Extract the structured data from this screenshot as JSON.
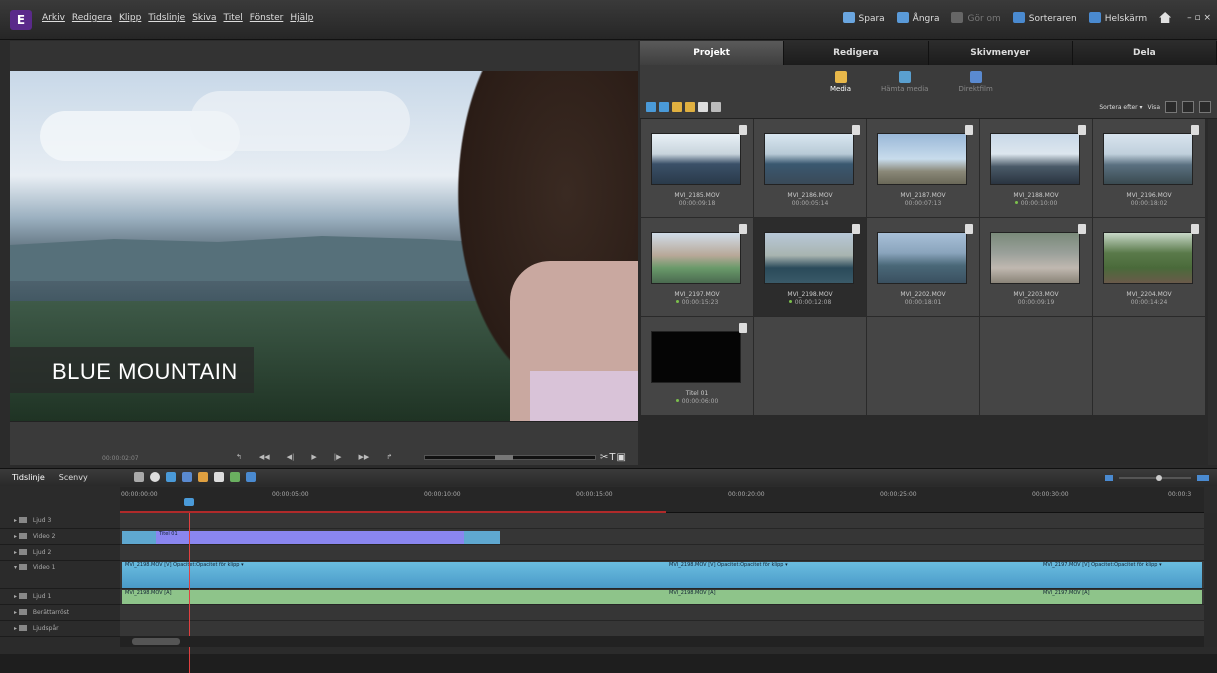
{
  "app": {
    "logo": "E"
  },
  "menu": [
    "Arkiv",
    "Redigera",
    "Klipp",
    "Tidslinje",
    "Skiva",
    "Titel",
    "Fönster",
    "Hjälp"
  ],
  "toolbar": {
    "save": "Spara",
    "undo": "Ångra",
    "redo": "Gör om",
    "sorter": "Sorteraren",
    "fullscreen": "Helskärm",
    "window_controls": "– ▫ ×"
  },
  "monitor": {
    "title_text": "BLUE MOUNTAIN",
    "timecode": "00:00:02:07"
  },
  "panel": {
    "tabs": [
      "Projekt",
      "Redigera",
      "Skivmenyer",
      "Dela"
    ],
    "subtabs": [
      "Media",
      "Hämta media",
      "Direktfilm"
    ],
    "sort_label": "Sortera efter",
    "view_label": "Visa",
    "media": [
      {
        "name": "MVI_2185.MOV",
        "duration": "00:00:09:18",
        "dot": false
      },
      {
        "name": "MVI_2186.MOV",
        "duration": "00:00:05:14",
        "dot": false
      },
      {
        "name": "MVI_2187.MOV",
        "duration": "00:00:07:13",
        "dot": false
      },
      {
        "name": "MVI_2188.MOV",
        "duration": "00:00:10:00",
        "dot": true
      },
      {
        "name": "MVI_2196.MOV",
        "duration": "00:00:18:02",
        "dot": false
      },
      {
        "name": "MVI_2197.MOV",
        "duration": "00:00:15:23",
        "dot": true
      },
      {
        "name": "MVI_2198.MOV",
        "duration": "00:00:12:08",
        "dot": true
      },
      {
        "name": "MVI_2202.MOV",
        "duration": "00:00:18:01",
        "dot": false
      },
      {
        "name": "MVI_2203.MOV",
        "duration": "00:00:09:19",
        "dot": false
      },
      {
        "name": "MVI_2204.MOV",
        "duration": "00:00:14:24",
        "dot": false
      },
      {
        "name": "Titel 01",
        "duration": "00:00:06:00",
        "dot": true
      }
    ]
  },
  "timeline": {
    "tabs": [
      "Tidslinje",
      "Scenvy"
    ],
    "ticks": [
      "00:00:00:00",
      "00:00:05:00",
      "00:00:10:00",
      "00:00:15:00",
      "00:00:20:00",
      "00:00:25:00",
      "00:00:30:00",
      "00:00:3"
    ],
    "tracks": [
      "Ljud 3",
      "Video 2",
      "Ljud 2",
      "Video 1",
      "Ljud 1",
      "Berättarröst",
      "Ljudspår"
    ],
    "title_clip": "Titel 01",
    "video_clips": [
      "MVI_2198.MOV [V]  Opacitet:Opacitet för klipp ▾",
      "MVI_2198.MOV [V]  Opacitet:Opacitet för klipp ▾",
      "MVI_2197.MOV [V]  Opacitet:Opacitet för klipp ▾"
    ],
    "audio_clips": [
      "MVI_2198.MOV [A]",
      "MVI_2198.MOV [A]",
      "MVI_2197.MOV [A]"
    ]
  },
  "colors": {
    "accent": "#4a9ad8",
    "playhead": "#e04040",
    "video_clip": "#5fb0d8",
    "audio_clip": "#8ec48a",
    "title_clip": "#8a86f0"
  }
}
